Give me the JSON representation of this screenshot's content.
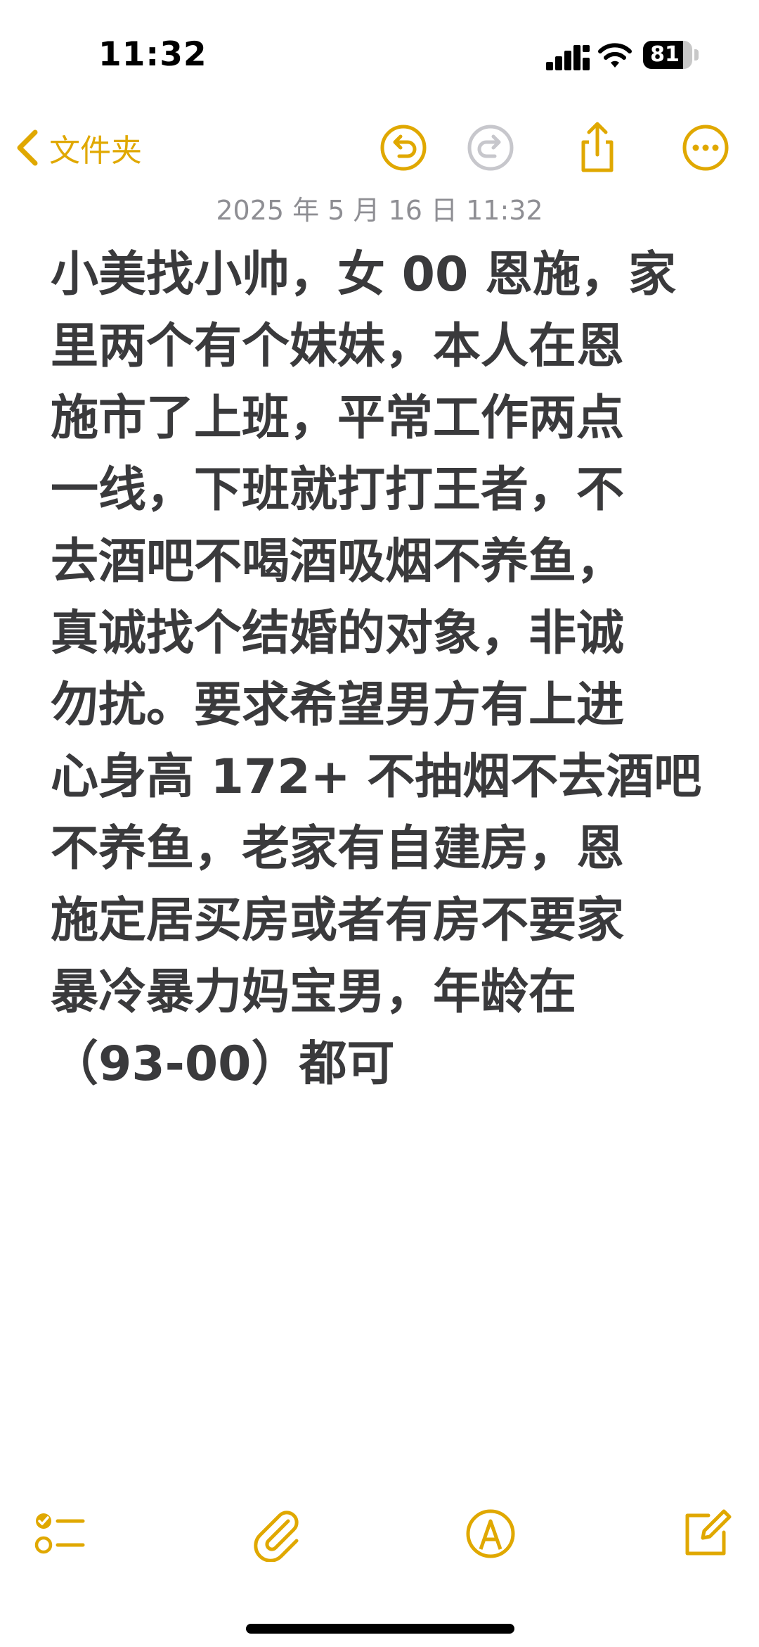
{
  "status_bar": {
    "time": "11:32",
    "battery_percent": "81",
    "battery_level": 0.81,
    "signal_icon": "cellular-signal-icon",
    "wifi_icon": "wifi-icon"
  },
  "nav": {
    "back_label": "文件夹",
    "icons": [
      "chevron-left-icon",
      "undo-icon",
      "redo-icon",
      "share-icon",
      "more-icon"
    ],
    "accent_color": "#e0a800"
  },
  "note": {
    "date": "2025 年 5 月 16 日 11:32",
    "lines": [
      "小美找小帅，女 00 恩施，家",
      "里两个有个妹妹，本人在恩",
      "施市了上班，平常工作两点",
      "一线，下班就打打王者，不",
      "去酒吧不喝酒吸烟不养鱼，",
      "真诚找个结婚的对象，非诚",
      "勿扰。要求希望男方有上进",
      "心身高 172+ 不抽烟不去酒吧",
      "不养鱼，老家有自建房，恩",
      "施定居买房或者有房不要家",
      "暴冷暴力妈宝男，年龄在",
      "（93-00）都可"
    ]
  },
  "toolbar": {
    "icons": [
      "checklist-icon",
      "paperclip-icon",
      "markup-pen-icon",
      "compose-icon"
    ]
  }
}
